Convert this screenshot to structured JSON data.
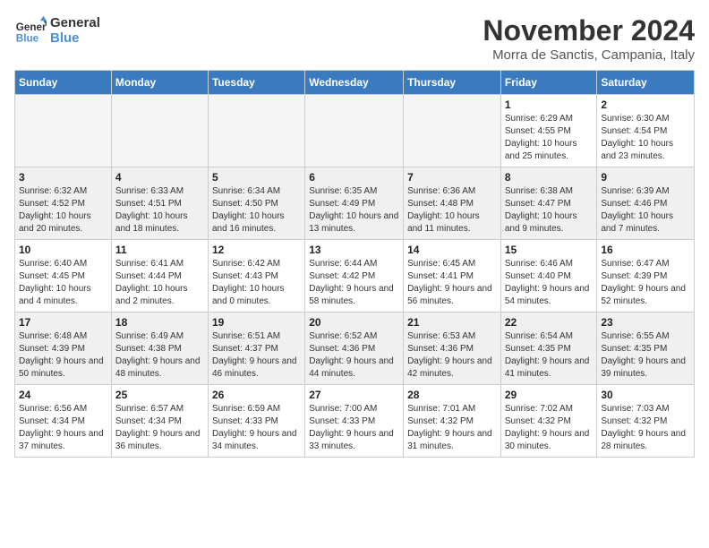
{
  "logo": {
    "line1": "General",
    "line2": "Blue"
  },
  "title": "November 2024",
  "location": "Morra de Sanctis, Campania, Italy",
  "days_of_week": [
    "Sunday",
    "Monday",
    "Tuesday",
    "Wednesday",
    "Thursday",
    "Friday",
    "Saturday"
  ],
  "weeks": [
    [
      {
        "day": "",
        "info": ""
      },
      {
        "day": "",
        "info": ""
      },
      {
        "day": "",
        "info": ""
      },
      {
        "day": "",
        "info": ""
      },
      {
        "day": "",
        "info": ""
      },
      {
        "day": "1",
        "info": "Sunrise: 6:29 AM\nSunset: 4:55 PM\nDaylight: 10 hours and 25 minutes."
      },
      {
        "day": "2",
        "info": "Sunrise: 6:30 AM\nSunset: 4:54 PM\nDaylight: 10 hours and 23 minutes."
      }
    ],
    [
      {
        "day": "3",
        "info": "Sunrise: 6:32 AM\nSunset: 4:52 PM\nDaylight: 10 hours and 20 minutes."
      },
      {
        "day": "4",
        "info": "Sunrise: 6:33 AM\nSunset: 4:51 PM\nDaylight: 10 hours and 18 minutes."
      },
      {
        "day": "5",
        "info": "Sunrise: 6:34 AM\nSunset: 4:50 PM\nDaylight: 10 hours and 16 minutes."
      },
      {
        "day": "6",
        "info": "Sunrise: 6:35 AM\nSunset: 4:49 PM\nDaylight: 10 hours and 13 minutes."
      },
      {
        "day": "7",
        "info": "Sunrise: 6:36 AM\nSunset: 4:48 PM\nDaylight: 10 hours and 11 minutes."
      },
      {
        "day": "8",
        "info": "Sunrise: 6:38 AM\nSunset: 4:47 PM\nDaylight: 10 hours and 9 minutes."
      },
      {
        "day": "9",
        "info": "Sunrise: 6:39 AM\nSunset: 4:46 PM\nDaylight: 10 hours and 7 minutes."
      }
    ],
    [
      {
        "day": "10",
        "info": "Sunrise: 6:40 AM\nSunset: 4:45 PM\nDaylight: 10 hours and 4 minutes."
      },
      {
        "day": "11",
        "info": "Sunrise: 6:41 AM\nSunset: 4:44 PM\nDaylight: 10 hours and 2 minutes."
      },
      {
        "day": "12",
        "info": "Sunrise: 6:42 AM\nSunset: 4:43 PM\nDaylight: 10 hours and 0 minutes."
      },
      {
        "day": "13",
        "info": "Sunrise: 6:44 AM\nSunset: 4:42 PM\nDaylight: 9 hours and 58 minutes."
      },
      {
        "day": "14",
        "info": "Sunrise: 6:45 AM\nSunset: 4:41 PM\nDaylight: 9 hours and 56 minutes."
      },
      {
        "day": "15",
        "info": "Sunrise: 6:46 AM\nSunset: 4:40 PM\nDaylight: 9 hours and 54 minutes."
      },
      {
        "day": "16",
        "info": "Sunrise: 6:47 AM\nSunset: 4:39 PM\nDaylight: 9 hours and 52 minutes."
      }
    ],
    [
      {
        "day": "17",
        "info": "Sunrise: 6:48 AM\nSunset: 4:39 PM\nDaylight: 9 hours and 50 minutes."
      },
      {
        "day": "18",
        "info": "Sunrise: 6:49 AM\nSunset: 4:38 PM\nDaylight: 9 hours and 48 minutes."
      },
      {
        "day": "19",
        "info": "Sunrise: 6:51 AM\nSunset: 4:37 PM\nDaylight: 9 hours and 46 minutes."
      },
      {
        "day": "20",
        "info": "Sunrise: 6:52 AM\nSunset: 4:36 PM\nDaylight: 9 hours and 44 minutes."
      },
      {
        "day": "21",
        "info": "Sunrise: 6:53 AM\nSunset: 4:36 PM\nDaylight: 9 hours and 42 minutes."
      },
      {
        "day": "22",
        "info": "Sunrise: 6:54 AM\nSunset: 4:35 PM\nDaylight: 9 hours and 41 minutes."
      },
      {
        "day": "23",
        "info": "Sunrise: 6:55 AM\nSunset: 4:35 PM\nDaylight: 9 hours and 39 minutes."
      }
    ],
    [
      {
        "day": "24",
        "info": "Sunrise: 6:56 AM\nSunset: 4:34 PM\nDaylight: 9 hours and 37 minutes."
      },
      {
        "day": "25",
        "info": "Sunrise: 6:57 AM\nSunset: 4:34 PM\nDaylight: 9 hours and 36 minutes."
      },
      {
        "day": "26",
        "info": "Sunrise: 6:59 AM\nSunset: 4:33 PM\nDaylight: 9 hours and 34 minutes."
      },
      {
        "day": "27",
        "info": "Sunrise: 7:00 AM\nSunset: 4:33 PM\nDaylight: 9 hours and 33 minutes."
      },
      {
        "day": "28",
        "info": "Sunrise: 7:01 AM\nSunset: 4:32 PM\nDaylight: 9 hours and 31 minutes."
      },
      {
        "day": "29",
        "info": "Sunrise: 7:02 AM\nSunset: 4:32 PM\nDaylight: 9 hours and 30 minutes."
      },
      {
        "day": "30",
        "info": "Sunrise: 7:03 AM\nSunset: 4:32 PM\nDaylight: 9 hours and 28 minutes."
      }
    ]
  ]
}
